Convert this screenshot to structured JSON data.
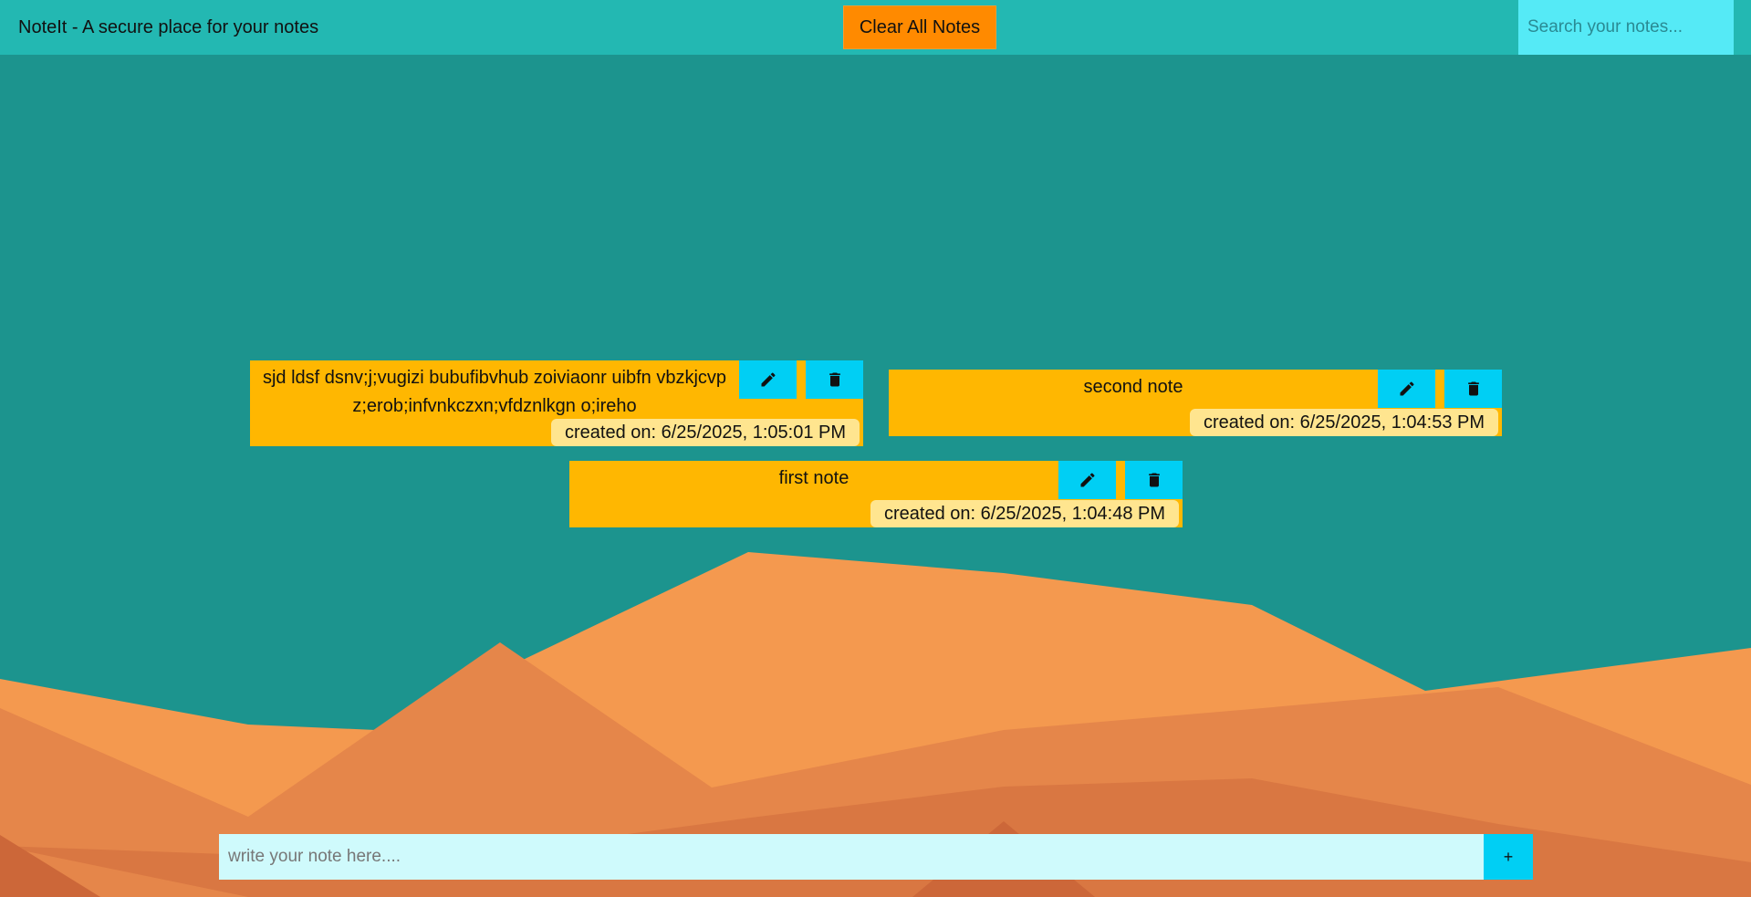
{
  "header": {
    "title": "NoteIt - A secure place for your notes",
    "clear_label": "Clear All Notes",
    "search_placeholder": "Search your notes..."
  },
  "notes": [
    {
      "text": "sjd ldsf dsnv;j;vugizi bubufibvhub zoiviaonr uibfn vbzkjcvp z;erob;infvnkczxn;vfdznlkgn o;ireho",
      "created": "created on: 6/25/2025, 1:05:01 PM"
    },
    {
      "text": "second note",
      "created": "created on: 6/25/2025, 1:04:53 PM"
    },
    {
      "text": "first note",
      "created": "created on: 6/25/2025, 1:04:48 PM"
    }
  ],
  "composer": {
    "placeholder": "write your note here....",
    "add_label": "+"
  },
  "colors": {
    "background": "#1c948e",
    "header": "#23b8b2",
    "accent": "#ff8a00",
    "note": "#ffb701",
    "icon_button": "#00cff4"
  },
  "icons": {
    "edit": "pencil-icon",
    "delete": "trash-icon"
  }
}
